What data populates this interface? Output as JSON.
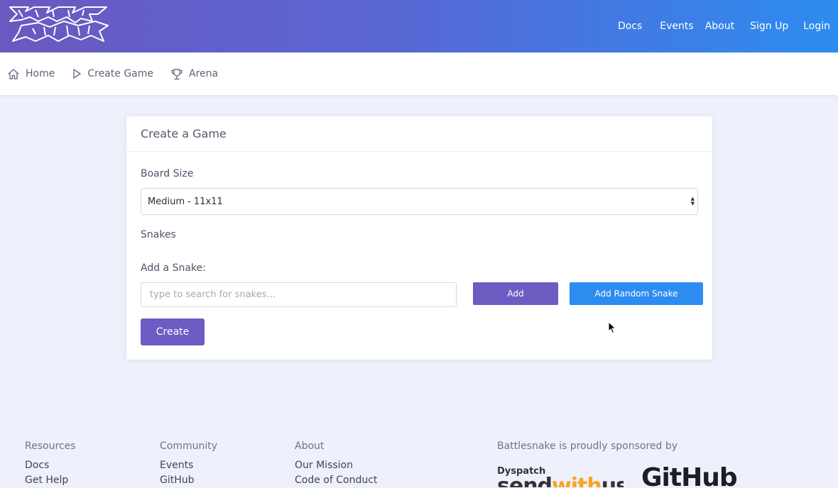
{
  "header": {
    "logo_text": "BATTLESNAKE",
    "nav": {
      "docs": "Docs",
      "events": "Events",
      "about": "About",
      "signup": "Sign Up",
      "login": "Login"
    }
  },
  "subnav": {
    "home": "Home",
    "create_game": "Create Game",
    "arena": "Arena"
  },
  "card": {
    "title": "Create a Game",
    "board_size_label": "Board Size",
    "board_size_value": "Medium - 11x11",
    "snakes_label": "Snakes",
    "add_snake_label": "Add a Snake:",
    "search_placeholder": "type to search for snakes...",
    "add_button": "Add",
    "add_random_button": "Add Random Snake",
    "create_button": "Create"
  },
  "footer": {
    "resources": {
      "heading": "Resources",
      "links": [
        "Docs",
        "Get Help"
      ]
    },
    "community": {
      "heading": "Community",
      "links": [
        "Events",
        "GitHub"
      ]
    },
    "about": {
      "heading": "About",
      "links": [
        "Our Mission",
        "Code of Conduct"
      ]
    },
    "sponsors": {
      "heading": "Battlesnake is proudly sponsored by",
      "sponsor1_small": "Dyspatch",
      "sponsor1_a": "send",
      "sponsor1_b": "with",
      "sponsor1_c": "us",
      "sponsor2": "GitHub"
    }
  },
  "colors": {
    "primary_purple": "#6b5dc2",
    "primary_blue": "#2d8cf0"
  }
}
